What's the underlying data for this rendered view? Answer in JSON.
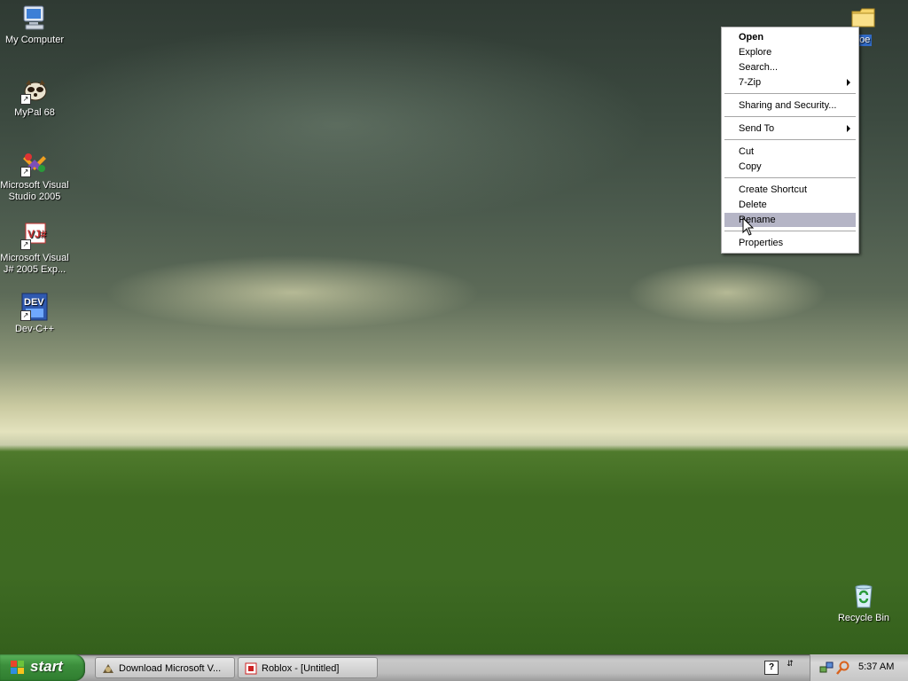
{
  "desktop": {
    "icons": [
      {
        "label": "My Computer",
        "icon": "my-computer-icon"
      },
      {
        "label": "MyPal 68",
        "icon": "mypal-icon"
      },
      {
        "label": "Microsoft Visual Studio 2005",
        "icon": "visual-studio-icon"
      },
      {
        "label": "Microsoft Visual J# 2005 Exp...",
        "icon": "visual-jsharp-icon"
      },
      {
        "label": "Dev-C++",
        "icon": "dev-cpp-icon"
      },
      {
        "label": "joe",
        "icon": "folder-icon"
      },
      {
        "label": "Recycle Bin",
        "icon": "recycle-bin-icon"
      }
    ]
  },
  "context_menu": {
    "items": [
      {
        "label": "Open",
        "bold": true
      },
      {
        "label": "Explore"
      },
      {
        "label": "Search..."
      },
      {
        "label": "7-Zip",
        "submenu": true
      },
      {
        "label": "Sharing and Security..."
      },
      {
        "label": "Send To",
        "submenu": true
      },
      {
        "label": "Cut"
      },
      {
        "label": "Copy"
      },
      {
        "label": "Create Shortcut"
      },
      {
        "label": "Delete"
      },
      {
        "label": "Rename",
        "highlighted": true
      },
      {
        "label": "Properties"
      }
    ]
  },
  "taskbar": {
    "start_label": "start",
    "tasks": [
      {
        "label": "Download Microsoft V...",
        "icon": "download-icon"
      },
      {
        "label": "Roblox - [Untitled]",
        "icon": "roblox-icon"
      }
    ],
    "tray": {
      "clock": "5:37 AM",
      "icons": [
        "help-icon",
        "network-icon",
        "search-icon"
      ]
    }
  },
  "colors": {
    "menu_highlight": "#b5b5c6",
    "start_green": "#3c8f3c"
  }
}
